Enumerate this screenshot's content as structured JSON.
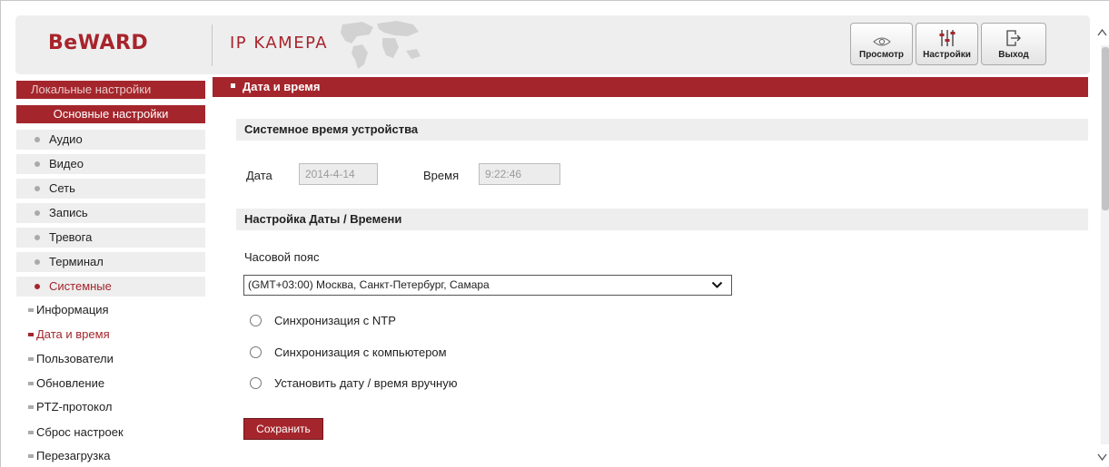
{
  "header": {
    "logo": "BeWARD",
    "product": "IP KAMEPA",
    "buttons": [
      {
        "label": "Просмотр",
        "icon": "eye-icon"
      },
      {
        "label": "Настройки",
        "icon": "sliders-icon"
      },
      {
        "label": "Выход",
        "icon": "exit-icon"
      }
    ]
  },
  "sidebar": {
    "local": "Локальные настройки",
    "basic": "Основные настройки",
    "items": [
      {
        "label": "Аудио"
      },
      {
        "label": "Видео"
      },
      {
        "label": "Сеть"
      },
      {
        "label": "Запись"
      },
      {
        "label": "Тревога"
      },
      {
        "label": "Терминал"
      },
      {
        "label": "Системные",
        "active": true
      }
    ],
    "sub_items": [
      {
        "label": "Информация"
      },
      {
        "label": "Дата и время",
        "active": true
      },
      {
        "label": "Пользователи"
      },
      {
        "label": "Обновление"
      },
      {
        "label": "PTZ-протокол"
      },
      {
        "label": "Сброс настроек"
      },
      {
        "label": "Перезагрузка"
      }
    ]
  },
  "main": {
    "page_title": "Дата и время",
    "system_time": {
      "title": "Системное время устройства",
      "date_label": "Дата",
      "date_value": "2014-4-14",
      "time_label": "Время",
      "time_value": "9:22:46"
    },
    "settings": {
      "title": "Настройка Даты / Времени",
      "timezone_label": "Часовой пояс",
      "timezone_value": "(GMT+03:00) Москва, Санкт-Петербург, Самара",
      "options": [
        "Синхронизация с NTP",
        "Синхронизация с компьютером",
        "Установить дату / время вручную"
      ]
    },
    "save_label": "Сохранить"
  },
  "colors": {
    "accent": "#a4262c",
    "panel": "#eeeeee"
  }
}
